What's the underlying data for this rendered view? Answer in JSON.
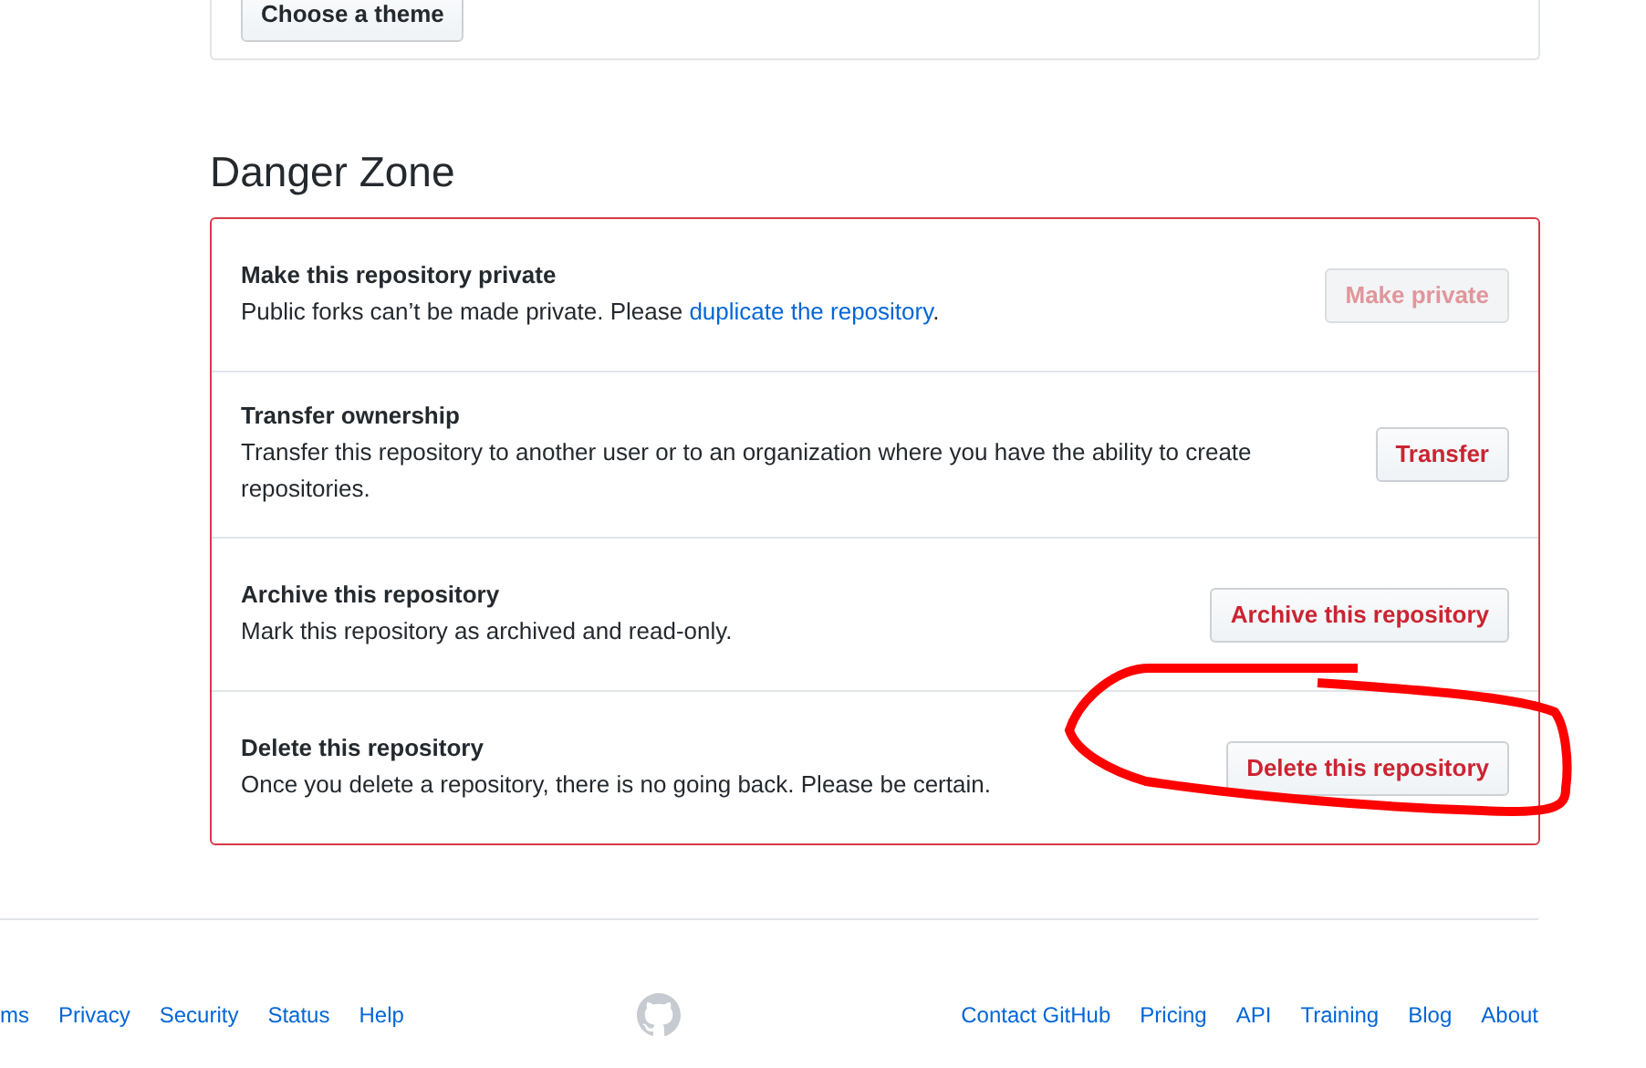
{
  "top_panel": {
    "button": "Choose a theme"
  },
  "danger_zone": {
    "title": "Danger Zone",
    "items": [
      {
        "title": "Make this repository private",
        "description": "Public forks can’t be made private. Please ",
        "link": "duplicate the repository",
        "after_link": ".",
        "button": "Make private",
        "disabled": true
      },
      {
        "title": "Transfer ownership",
        "description": "Transfer this repository to another user or to an organization where you have the ability to create repositories.",
        "button": "Transfer",
        "disabled": false
      },
      {
        "title": "Archive this repository",
        "description": "Mark this repository as archived and read-only.",
        "button": "Archive this repository",
        "disabled": false
      },
      {
        "title": "Delete this repository",
        "description": "Once you delete a repository, there is no going back. Please be certain.",
        "button": "Delete this repository",
        "disabled": false,
        "circled": true
      }
    ]
  },
  "footer": {
    "left_links": [
      "ms",
      "Privacy",
      "Security",
      "Status",
      "Help"
    ],
    "right_links": [
      "Contact GitHub",
      "Pricing",
      "API",
      "Training",
      "Blog",
      "About"
    ]
  }
}
